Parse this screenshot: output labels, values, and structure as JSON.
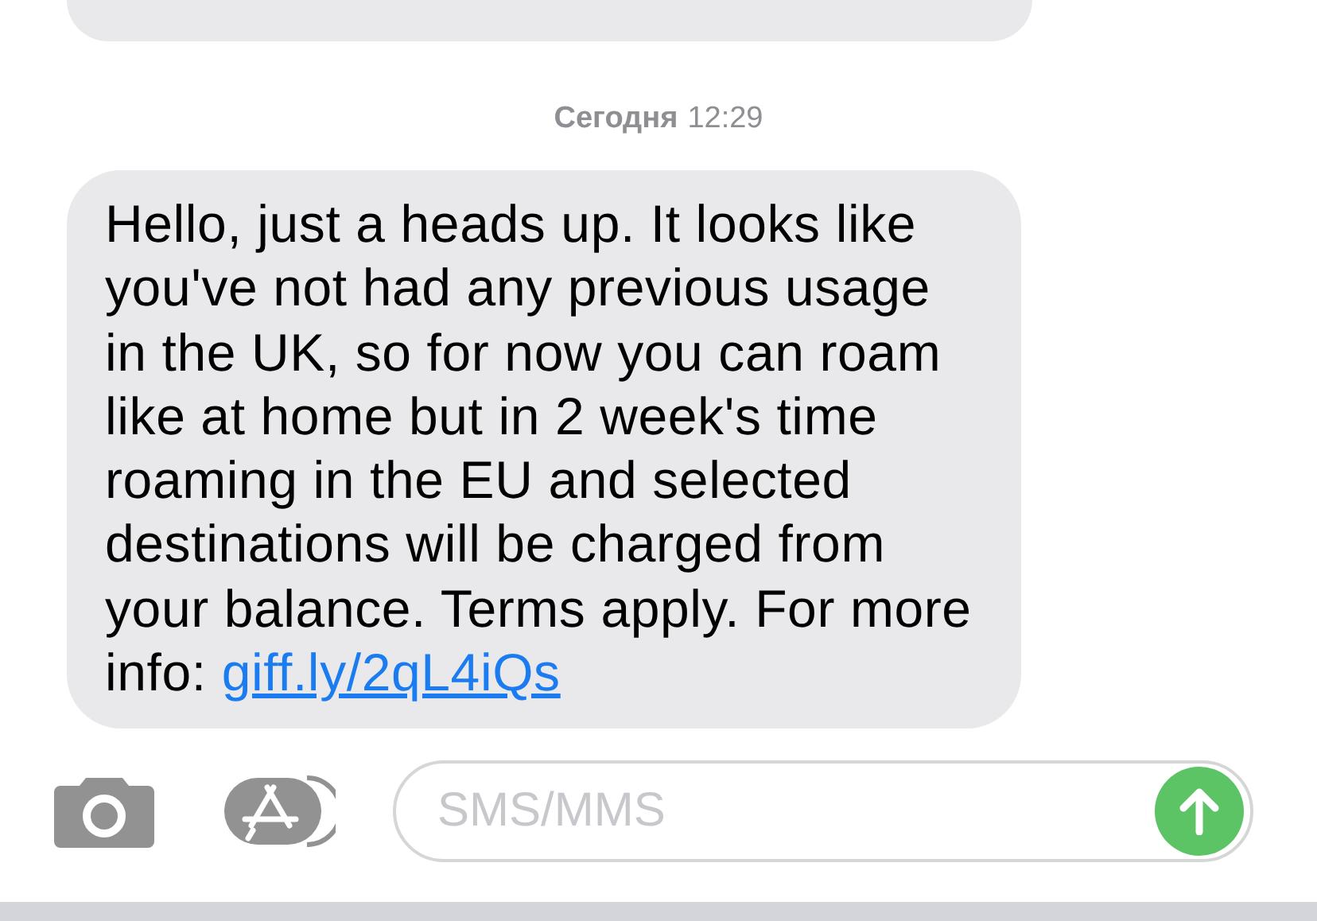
{
  "timestamp": {
    "day": "Сегодня",
    "time": "12:29"
  },
  "message": {
    "text": "Hello, just a heads up. It looks like you've not had any previous usage in the UK, so for now you can roam like at home but in 2 week's time roaming in the EU and selected destinations will be charged from your balance. Terms apply. For more info:",
    "link": "giff.ly/2qL4iQs"
  },
  "composer": {
    "placeholder": "SMS/MMS"
  }
}
